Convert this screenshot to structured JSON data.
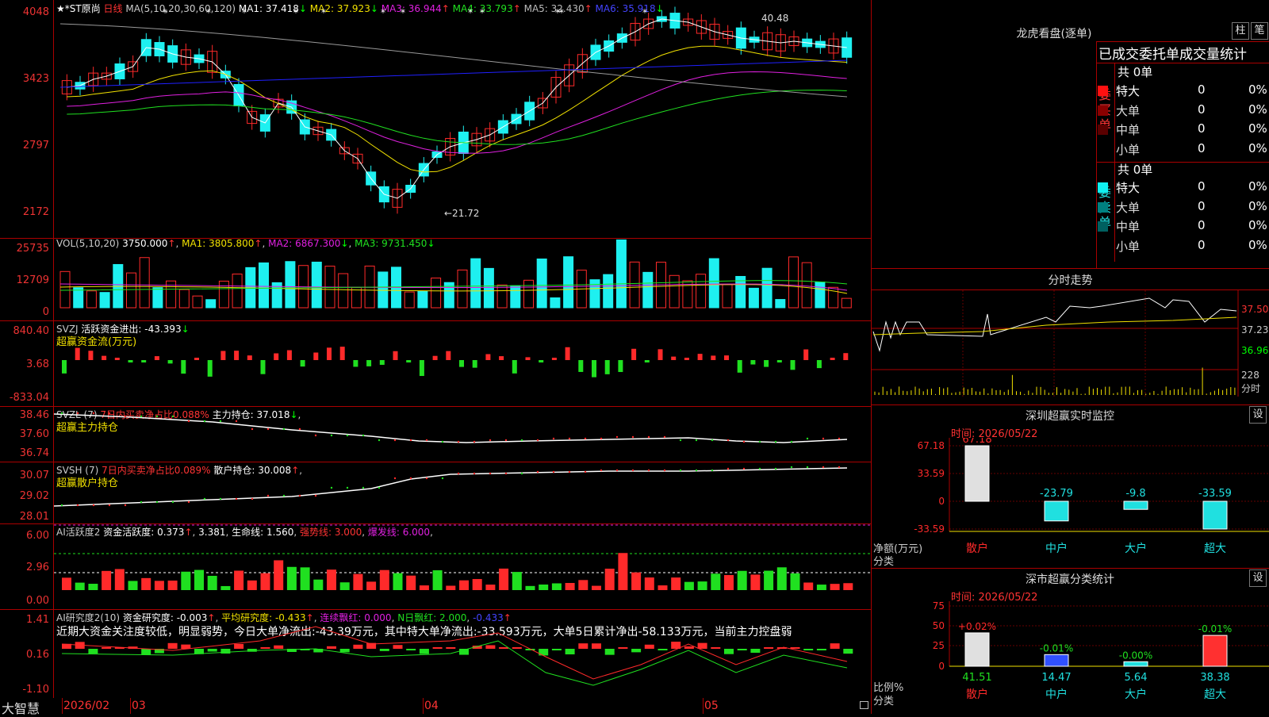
{
  "colors": {
    "up": "#ff2a2a",
    "down": "#1ef0f0",
    "ma1": "#ffffff",
    "ma2": "#f0e000",
    "ma3": "#e020e0",
    "ma4": "#20e020",
    "ma5": "#9a9a9a",
    "ma6": "#2020ff",
    "grid": "#aa0000"
  },
  "price_pane": {
    "legend_prefix": "★*ST原尚",
    "period": "日线",
    "ma_label": "MA(5,10,20,30,60,120)",
    "ma1": "MA1: 37.418",
    "ma2": "MA2: 37.923",
    "ma3": "MA3: 36.944",
    "ma4": "MA4: 33.793",
    "ma5": "MA5: 32.430",
    "ma6": "MA6: 35.918",
    "axis": [
      "4048",
      "3423",
      "2797",
      "2172"
    ],
    "high_note": "40.48",
    "low_note": "←21.72"
  },
  "vol_pane": {
    "label": "VOL(5,10,20)",
    "value": "3750.000",
    "ma1": "MA1: 3805.800",
    "ma2": "MA2: 6867.300",
    "ma3": "MA3: 9731.450",
    "axis": [
      "25735",
      "12709",
      "0"
    ]
  },
  "svzj_pane": {
    "label": "SVZJ",
    "title": "活跃资金进出: -43.393",
    "sub": "超赢资金流(万元)",
    "axis": [
      "840.40",
      "3.68",
      "-833.04"
    ]
  },
  "svzl_pane": {
    "label": "SVZL (7)",
    "ratio": "7日内买卖净占比0.088%",
    "hold": "主力持仓: 37.018",
    "sub": "超赢主力持仓",
    "axis": [
      "38.46",
      "37.60",
      "36.74"
    ]
  },
  "svsh_pane": {
    "label": "SVSH (7)",
    "ratio": "7日内买卖净占比0.089%",
    "hold": "散户持仓: 30.008",
    "sub": "超赢散户持仓",
    "axis": [
      "30.07",
      "29.02",
      "28.01"
    ]
  },
  "ai_pane": {
    "label": "AI活跃度2",
    "active": "资金活跃度: 0.373",
    "v2": "3.381",
    "life": "生命线: 1.560",
    "strong": "强势线: 3.000",
    "burst": "爆发线: 6.000",
    "axis": [
      "6.00",
      "2.96",
      "0.00"
    ]
  },
  "research_pane": {
    "label": "AI研究度2(10)",
    "research": "资金研究度: -0.003",
    "avg": "平均研究度: -0.433",
    "cont": "连续飘红: 0.000",
    "nday": "N日飘红: 2.000",
    "last": "-0.433",
    "comment": "近期大资金关注度较低，明显弱势，今日大单净流出:-43.39万元，其中特大单净流出:-33.593万元，大单5日累计净出-58.133万元，当前主力控盘弱",
    "axis": [
      "1.41",
      "0.16",
      "-1.10"
    ]
  },
  "footer": {
    "brand": "大智慧",
    "dates": [
      "2026/02",
      "03",
      "04",
      "05"
    ]
  },
  "right": {
    "dragon_title": "龙虎看盘(逐单)",
    "tab_bar": "柱",
    "tab_pen": "笔",
    "header": "已成交委托单成交量统计",
    "buy": {
      "side": "委买单",
      "total": "共 0单",
      "rows": [
        {
          "name": "特大",
          "count": "0",
          "pct": "0%"
        },
        {
          "name": "大单",
          "count": "0",
          "pct": "0%"
        },
        {
          "name": "中单",
          "count": "0",
          "pct": "0%"
        },
        {
          "name": "小单",
          "count": "0",
          "pct": "0%"
        }
      ]
    },
    "sell": {
      "side": "委卖单",
      "total": "共 0单",
      "rows": [
        {
          "name": "特大",
          "count": "0",
          "pct": "0%"
        },
        {
          "name": "大单",
          "count": "0",
          "pct": "0%"
        },
        {
          "name": "中单",
          "count": "0",
          "pct": "0%"
        },
        {
          "name": "小单",
          "count": "0",
          "pct": "0%"
        }
      ]
    },
    "intraday_title": "分时走势",
    "intraday_axis": [
      "37.50",
      "37.23",
      "36.96"
    ],
    "intraday_vol": "228",
    "intraday_vol_unit": "分时",
    "monitor1": {
      "title": "深圳超赢实时监控",
      "time": "时间: 2026/05/22",
      "set": "设",
      "axis": [
        "67.18",
        "33.59",
        "0",
        "-33.59"
      ],
      "ylabel": "净额(万元)",
      "xlabel": "分类",
      "bars": [
        {
          "cat": "散户",
          "value": 67.18,
          "label": "67.18"
        },
        {
          "cat": "中户",
          "value": -23.79,
          "label": "-23.79"
        },
        {
          "cat": "大户",
          "value": -9.8,
          "label": "-9.8"
        },
        {
          "cat": "超大",
          "value": -33.59,
          "label": "-33.59"
        }
      ]
    },
    "monitor2": {
      "title": "深市超赢分类统计",
      "time": "时间: 2026/05/22",
      "set": "设",
      "axis": [
        "75",
        "50",
        "25",
        "0"
      ],
      "ylabel": "比例%",
      "xlabel": "分类",
      "bars": [
        {
          "cat": "散户",
          "value": 41.51,
          "label": "41.51",
          "delta": "+0.02%"
        },
        {
          "cat": "中户",
          "value": 14.47,
          "label": "14.47",
          "delta": "-0.01%"
        },
        {
          "cat": "大户",
          "value": 5.64,
          "label": "5.64",
          "delta": "-0.00%"
        },
        {
          "cat": "超大",
          "value": 38.38,
          "label": "38.38",
          "delta": "-0.01%"
        }
      ]
    }
  }
}
